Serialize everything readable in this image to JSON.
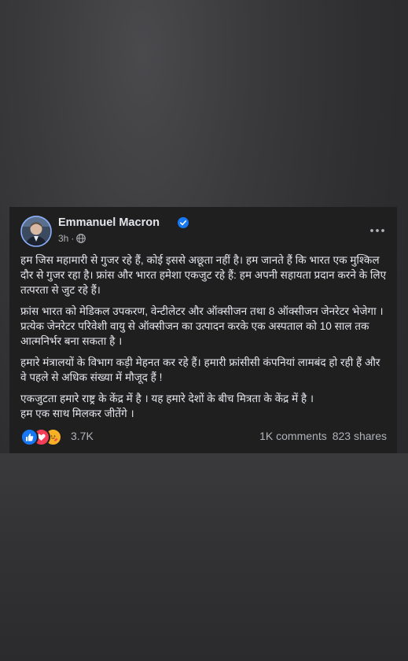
{
  "post": {
    "author": "Emmanuel Macron",
    "verified": true,
    "time": "3h",
    "separator": "·",
    "audience_icon": "globe-icon",
    "more_icon": "more-options-icon",
    "paragraphs": [
      "हम जिस महामारी से गुजर रहे हैं, कोई इससे अछूता नहीं है। हम जानते हैं कि भारत एक मुश्किल दौर से गुजर रहा है। फ्रांस और भारत हमेशा एकजुट रहे हैं: हम अपनी सहायता प्रदान करने के लिए तत्परता से जुट रहे हैं।",
      "फ्रांस भारत को मेडिकल उपकरण, वेन्टीलेटर और ऑक्सीजन तथा 8 ऑक्सीजन जेनरेटर भेजेगा । प्रत्येक जेनरेटर परिवेशी वायु से ऑक्सीजन का उत्पादन करके एक अस्पताल को 10 साल तक आत्मनिर्भर बना सकता है ।",
      "हमारे मंत्रालयों के विभाग कड़ी मेहनत कर रहे हैं। हमारी फ्रांसीसी कंपनियां लामबंद हो रही हैं और वे पहले से अधिक संख्या में मौजूद हैं !",
      "एकजुटता हमारे राष्ट्र के केंद्र में है । यह हमारे देशों के बीच मित्रता के केंद्र में है ।\nहम एक साथ मिलकर जीतेंगे ।"
    ],
    "reactions": {
      "icons": [
        "like-icon",
        "love-icon",
        "care-icon"
      ],
      "count": "3.7K"
    },
    "comments": "1K comments",
    "shares": "823 shares"
  },
  "colors": {
    "card_bg": "#1f1f20",
    "text": "#e4e6eb",
    "secondary_text": "#b0b3b8",
    "verified_blue": "#1877f2",
    "like_blue": "#1877f2",
    "love_red": "#f33e58",
    "care_yellow": "#f7b125"
  }
}
